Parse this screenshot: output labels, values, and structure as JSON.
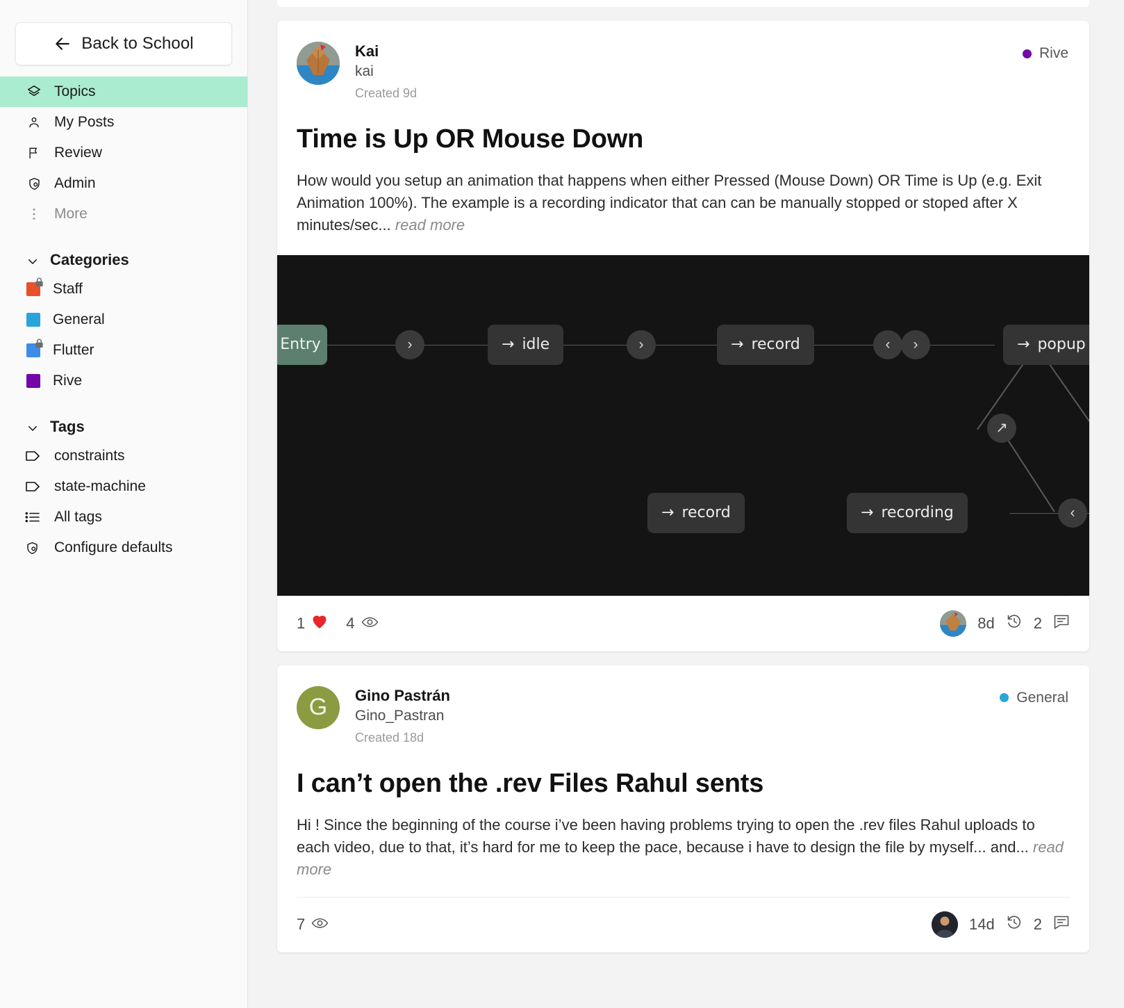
{
  "sidebar": {
    "back_button": {
      "label": "Back to School",
      "icon": "arrow-left-icon"
    },
    "nav": [
      {
        "label": "Topics",
        "icon": "layers-icon",
        "active": true
      },
      {
        "label": "My Posts",
        "icon": "person-icon",
        "active": false
      },
      {
        "label": "Review",
        "icon": "flag-icon",
        "active": false
      },
      {
        "label": "Admin",
        "icon": "shield-person-icon",
        "active": false
      },
      {
        "label": "More",
        "icon": "dots-vertical-icon",
        "active": false,
        "muted": true
      }
    ],
    "categories_header": "Categories",
    "categories": [
      {
        "label": "Staff",
        "color": "#e8502a",
        "locked": true
      },
      {
        "label": "General",
        "color": "#29a5dc",
        "locked": false
      },
      {
        "label": "Flutter",
        "color": "#3d8ce8",
        "locked": true
      },
      {
        "label": "Rive",
        "color": "#7307a8",
        "locked": false
      }
    ],
    "tags_header": "Tags",
    "tags": [
      {
        "label": "constraints",
        "icon": "tag-icon"
      },
      {
        "label": "state-machine",
        "icon": "tag-icon"
      },
      {
        "label": "All tags",
        "icon": "list-icon"
      },
      {
        "label": "Configure defaults",
        "icon": "shield-gear-icon"
      }
    ]
  },
  "posts": [
    {
      "author_name": "Kai",
      "author_handle": "kai",
      "created": "Created 9d",
      "badge_label": "Rive",
      "badge_color": "#7307a8",
      "title": "Time is Up OR Mouse Down",
      "body": "How would you setup an animation that happens when either Pressed (Mouse Down) OR Time is Up (e.g. Exit Animation 100%). The example is a recording indicator that can can be manually stopped or stoped after X minutes/sec...",
      "read_more": "read more",
      "likes": "1",
      "views": "4",
      "last_activity": "8d",
      "replies": "2",
      "has_media": true,
      "media": {
        "type": "state-machine-graph",
        "background": "#141414",
        "nodes": [
          {
            "label": "Entry",
            "kind": "entry"
          },
          {
            "label": "idle",
            "kind": "state"
          },
          {
            "label": "record",
            "kind": "state"
          },
          {
            "label": "popup",
            "kind": "state"
          },
          {
            "label": "record",
            "kind": "state"
          },
          {
            "label": "recording",
            "kind": "state"
          }
        ]
      }
    },
    {
      "author_name": "Gino Pastrán",
      "author_handle": "Gino_Pastran",
      "created": "Created 18d",
      "badge_label": "General",
      "badge_color": "#29a5dc",
      "title": "I can’t open the .rev Files Rahul sents",
      "body": "Hi ! Since the beginning of the course i’ve been having problems trying to open the .rev files Rahul uploads to each video, due to that, it’s hard for me to keep the pace, because i have to design the file by myself... and...",
      "read_more": "read more",
      "likes": null,
      "views": "7",
      "last_activity": "14d",
      "replies": "2",
      "has_media": false,
      "avatar_letter": "G"
    }
  ],
  "icons": {
    "heart": "heart-icon",
    "eye": "eye-icon",
    "history": "history-icon",
    "comment": "comment-icon"
  }
}
